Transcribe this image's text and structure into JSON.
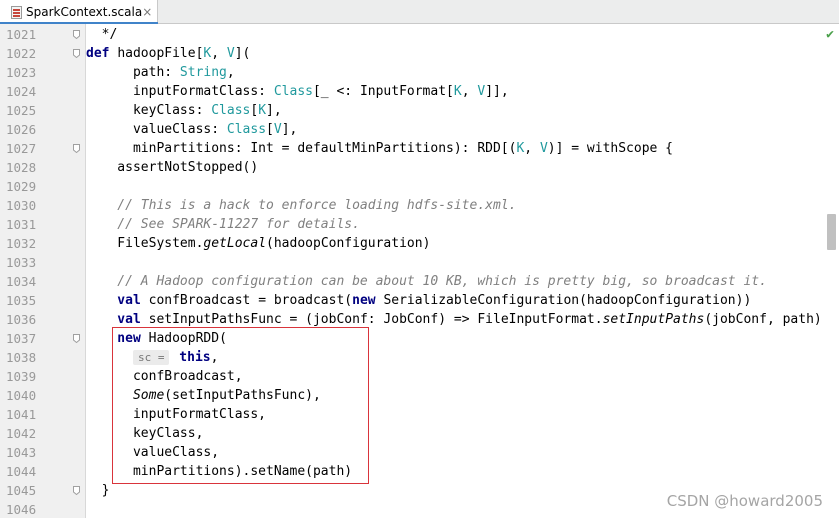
{
  "tab": {
    "title": "SparkContext.scala",
    "close": "×"
  },
  "status": {
    "check": "✔"
  },
  "watermark": "CSDN @howard2005",
  "lines": [
    {
      "n": "1021",
      "tokens": [
        [
          "",
          "  */"
        ]
      ]
    },
    {
      "n": "1022",
      "tokens": [
        [
          "kw",
          "def "
        ],
        [
          "",
          "hadoopFile["
        ],
        [
          "ty",
          "K"
        ],
        [
          "",
          ", "
        ],
        [
          "ty",
          "V"
        ],
        [
          "",
          "]("
        ]
      ]
    },
    {
      "n": "1023",
      "tokens": [
        [
          "",
          "      path: "
        ],
        [
          "ty",
          "String"
        ],
        [
          "",
          ","
        ]
      ]
    },
    {
      "n": "1024",
      "tokens": [
        [
          "",
          "      inputFormatClass: "
        ],
        [
          "ty",
          "Class"
        ],
        [
          "",
          "[_ <: InputFormat["
        ],
        [
          "ty",
          "K"
        ],
        [
          "",
          ", "
        ],
        [
          "ty",
          "V"
        ],
        [
          "",
          "]],"
        ]
      ]
    },
    {
      "n": "1025",
      "tokens": [
        [
          "",
          "      keyClass: "
        ],
        [
          "ty",
          "Class"
        ],
        [
          "",
          "["
        ],
        [
          "ty",
          "K"
        ],
        [
          "",
          "],"
        ]
      ]
    },
    {
      "n": "1026",
      "tokens": [
        [
          "",
          "      valueClass: "
        ],
        [
          "ty",
          "Class"
        ],
        [
          "",
          "["
        ],
        [
          "ty",
          "V"
        ],
        [
          "",
          "],"
        ]
      ]
    },
    {
      "n": "1027",
      "tokens": [
        [
          "",
          "      minPartitions: Int = defaultMinPartitions): RDD[("
        ],
        [
          "ty",
          "K"
        ],
        [
          "",
          ", "
        ],
        [
          "ty",
          "V"
        ],
        [
          "",
          ")] = withScope {"
        ]
      ]
    },
    {
      "n": "1028",
      "tokens": [
        [
          "",
          "    assertNotStopped()"
        ]
      ]
    },
    {
      "n": "1029",
      "tokens": []
    },
    {
      "n": "1030",
      "tokens": [
        [
          "cm",
          "    // This is a hack to enforce loading hdfs-site.xml."
        ]
      ]
    },
    {
      "n": "1031",
      "tokens": [
        [
          "cm",
          "    // See SPARK-11227 for details."
        ]
      ]
    },
    {
      "n": "1032",
      "tokens": [
        [
          "",
          "    FileSystem."
        ],
        [
          "it",
          "getLocal"
        ],
        [
          "",
          "(hadoopConfiguration)"
        ]
      ]
    },
    {
      "n": "1033",
      "tokens": []
    },
    {
      "n": "1034",
      "tokens": [
        [
          "cm",
          "    // A Hadoop configuration can be about 10 KB, which is pretty big, so broadcast it."
        ]
      ]
    },
    {
      "n": "1035",
      "tokens": [
        [
          "kw",
          "    val "
        ],
        [
          "",
          "confBroadcast = broadcast("
        ],
        [
          "kw",
          "new "
        ],
        [
          "",
          "SerializableConfiguration(hadoopConfiguration))"
        ]
      ]
    },
    {
      "n": "1036",
      "tokens": [
        [
          "kw",
          "    val "
        ],
        [
          "",
          "setInputPathsFunc = (jobConf: JobConf) => FileInputFormat."
        ],
        [
          "it",
          "setInputPaths"
        ],
        [
          "",
          "(jobConf, path)"
        ]
      ]
    },
    {
      "n": "1037",
      "tokens": [
        [
          "kw",
          "    new "
        ],
        [
          "",
          "HadoopRDD("
        ]
      ]
    },
    {
      "n": "1038",
      "tokens": [
        [
          "",
          "      "
        ],
        [
          "hint",
          "sc ="
        ],
        [
          "kw",
          " this"
        ],
        [
          "",
          ","
        ]
      ]
    },
    {
      "n": "1039",
      "tokens": [
        [
          "",
          "      confBroadcast,"
        ]
      ]
    },
    {
      "n": "1040",
      "tokens": [
        [
          "",
          "      "
        ],
        [
          "it",
          "Some"
        ],
        [
          "",
          "(setInputPathsFunc),"
        ]
      ]
    },
    {
      "n": "1041",
      "tokens": [
        [
          "",
          "      inputFormatClass,"
        ]
      ]
    },
    {
      "n": "1042",
      "tokens": [
        [
          "",
          "      keyClass,"
        ]
      ]
    },
    {
      "n": "1043",
      "tokens": [
        [
          "",
          "      valueClass,"
        ]
      ]
    },
    {
      "n": "1044",
      "tokens": [
        [
          "",
          "      minPartitions).setName(path)"
        ]
      ]
    },
    {
      "n": "1045",
      "tokens": [
        [
          "",
          "  }"
        ]
      ]
    },
    {
      "n": "1046",
      "tokens": []
    }
  ]
}
